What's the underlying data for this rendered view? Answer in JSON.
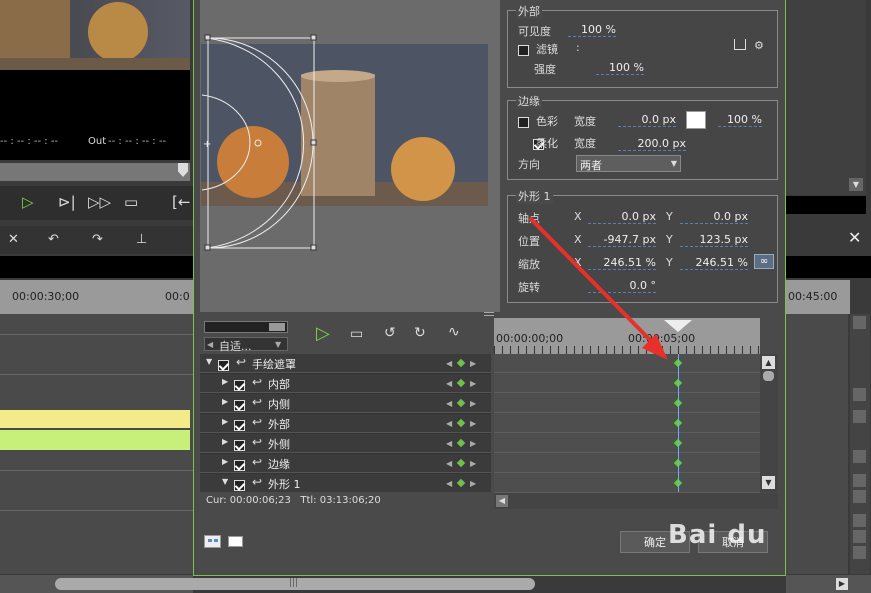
{
  "left_panel": {
    "timecode": "-- : -- : -- : --",
    "out_label": "Out",
    "out_timecode": "-- : -- : -- : --",
    "ruler_time1": "00:00:30;00",
    "ruler_time2": "00:0"
  },
  "right_panel": {
    "ruler_time": "00:45:00"
  },
  "outer": {
    "title": "外部",
    "visibility_label": "可见度",
    "visibility_value": "100 %",
    "filter_label": "滤镜",
    "filter_value": ":",
    "strength_label": "强度",
    "strength_value": "100 %"
  },
  "edge": {
    "title": "边缘",
    "color_label": "色彩",
    "width_label1": "宽度",
    "width_value1": "0.0 px",
    "opacity_value": "100 %",
    "soft_label": "柔化",
    "width_label2": "宽度",
    "width_value2": "200.0 px",
    "direction_label": "方向",
    "direction_value": "两者",
    "color_swatch": "#ffffff"
  },
  "shape": {
    "title": "外形 1",
    "pivot_label": "轴点",
    "pivot_x_label": "X",
    "pivot_x": "0.0 px",
    "pivot_y_label": "Y",
    "pivot_y": "0.0 px",
    "pos_label": "位置",
    "pos_x_label": "X",
    "pos_x": "-947.7 px",
    "pos_y_label": "Y",
    "pos_y": "123.5 px",
    "scale_label": "缩放",
    "scale_x_label": "X",
    "scale_x": "246.51 %",
    "scale_y_label": "Y",
    "scale_y": "246.51 %",
    "rotate_label": "旋转",
    "rotate_value": "0.0 °"
  },
  "timeline": {
    "mode_label": "自适...",
    "ruler_start": "00:00:00;00",
    "ruler_mid": "00:00:05;00",
    "tracks": [
      {
        "label": "手绘遮罩",
        "level": 0,
        "expanded": true
      },
      {
        "label": "内部",
        "level": 1,
        "expanded": false
      },
      {
        "label": "内侧",
        "level": 1,
        "expanded": false
      },
      {
        "label": "外部",
        "level": 1,
        "expanded": false
      },
      {
        "label": "外侧",
        "level": 1,
        "expanded": false
      },
      {
        "label": "边缘",
        "level": 1,
        "expanded": false
      },
      {
        "label": "外形 1",
        "level": 1,
        "expanded": true
      }
    ],
    "status": "Cur: 00:00:06;23   Ttl: 03:13:06;20",
    "keyframe_color": "#6fbf4a"
  },
  "footer": {
    "ok_label": "确定",
    "cancel_label": "取消",
    "watermark": "Bai du"
  },
  "colors": {
    "accent_green": "#7ad042",
    "annotation_arrow": "#e8302a"
  }
}
